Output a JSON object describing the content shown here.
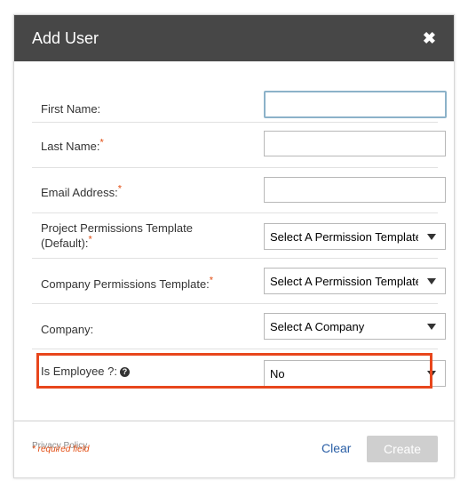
{
  "dialog": {
    "title": "Add User",
    "close_symbol": "✖"
  },
  "fields": {
    "first_name": {
      "label": "First Name:",
      "value": ""
    },
    "last_name": {
      "label": "Last Name:",
      "required_mark": "*",
      "value": ""
    },
    "email": {
      "label": "Email Address:",
      "required_mark": "*",
      "value": ""
    },
    "project_template": {
      "label_line1": "Project Permissions Template",
      "label_line2": "(Default):",
      "required_mark": "*",
      "selected": "Select A Permission Template"
    },
    "company_template": {
      "label": "Company Permissions Template:",
      "required_mark": "*",
      "selected": "Select A Permission Template"
    },
    "company": {
      "label": "Company:",
      "selected": "Select A Company"
    },
    "is_employee": {
      "label": "Is Employee ?:",
      "help_symbol": "?",
      "selected": "No"
    }
  },
  "links": {
    "privacy_policy": "Privacy Policy"
  },
  "footer": {
    "required_note": "* required field",
    "clear_label": "Clear",
    "create_label": "Create"
  },
  "colors": {
    "header_bg": "#474747",
    "highlight": "#e8461c",
    "required": "#e34d12",
    "link": "#2a5fa6",
    "disabled_button": "#cfcfcf"
  },
  "icons": {
    "close": "close-icon",
    "help": "help-icon",
    "dropdown": "chevron-down-icon"
  }
}
